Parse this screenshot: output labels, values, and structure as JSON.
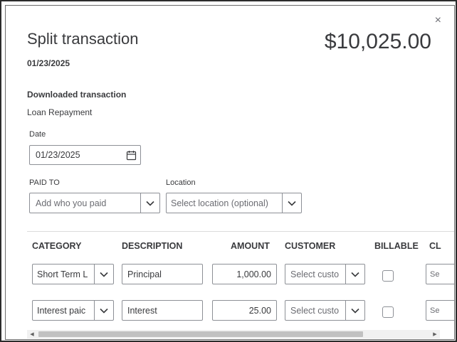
{
  "dialog": {
    "title": "Split transaction",
    "date": "01/23/2025",
    "amount": "$10,025.00",
    "close_label": "×"
  },
  "downloaded": {
    "heading": "Downloaded transaction",
    "description": "Loan Repayment"
  },
  "form": {
    "date_label": "Date",
    "date_value": "01/23/2025",
    "paid_to_label": "PAID TO",
    "paid_to_placeholder": "Add who you paid",
    "location_label": "Location",
    "location_placeholder": "Select location (optional)"
  },
  "table": {
    "headers": {
      "category": "CATEGORY",
      "description": "DESCRIPTION",
      "amount": "AMOUNT",
      "customer": "CUSTOMER",
      "billable": "BILLABLE",
      "class": "CL"
    },
    "rows": [
      {
        "category": "Short Term L",
        "description": "Principal",
        "amount": "1,000.00",
        "customer_placeholder": "Select custo",
        "billable": false,
        "class_placeholder": "Se"
      },
      {
        "category": "Interest paic",
        "description": "Interest",
        "amount": "25.00",
        "customer_placeholder": "Select custo",
        "billable": false,
        "class_placeholder": "Se"
      }
    ]
  },
  "scrollbar": {
    "left_arrow": "◀",
    "right_arrow": "▶"
  },
  "icons": {
    "calendar": "calendar-icon",
    "chevron": "chevron-down-icon",
    "close": "close-icon"
  }
}
